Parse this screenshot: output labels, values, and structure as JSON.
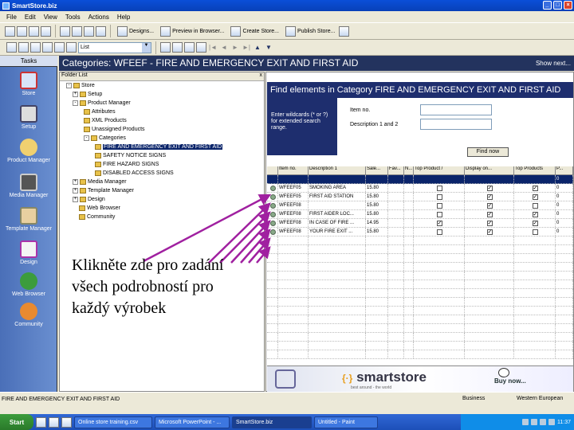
{
  "window": {
    "title": "SmartStore.biz"
  },
  "menu": [
    "File",
    "Edit",
    "View",
    "Tools",
    "Actions",
    "Help"
  ],
  "toolbar1": {
    "buttons": [
      {
        "label": "Designs..."
      },
      {
        "label": "Preview in Browser..."
      },
      {
        "label": "Create Store..."
      },
      {
        "label": "Publish Store..."
      }
    ]
  },
  "toolbar2": {
    "combo_value": "List"
  },
  "tasks": {
    "header": "Tasks",
    "items": [
      {
        "label": "Store",
        "icon": "store-icon"
      },
      {
        "label": "Setup",
        "icon": "setup-icon"
      },
      {
        "label": "Product Manager",
        "icon": "product-manager-icon"
      },
      {
        "label": "Media Manager",
        "icon": "media-manager-icon"
      },
      {
        "label": "Template Manager",
        "icon": "template-manager-icon"
      },
      {
        "label": "Design",
        "icon": "design-icon"
      },
      {
        "label": "Web Browser",
        "icon": "web-browser-icon"
      },
      {
        "label": "Community",
        "icon": "community-icon"
      }
    ]
  },
  "category_header": {
    "title": "Categories: WFEEF - FIRE AND EMERGENCY EXIT AND FIRST AID",
    "show_link": "Show next..."
  },
  "tree": {
    "header": "Folder List",
    "close": "x",
    "nodes": [
      {
        "label": "Store"
      },
      {
        "label": "Setup"
      },
      {
        "label": "Product Manager"
      },
      {
        "label": "Attributes"
      },
      {
        "label": "XML Products"
      },
      {
        "label": "Unassigned Products"
      },
      {
        "label": "Categories"
      },
      {
        "label": "FIRE AND EMERGENCY EXIT AND FIRST AID"
      },
      {
        "label": "SAFETY NOTICE SIGNS"
      },
      {
        "label": "FIRE HAZARD SIGNS"
      },
      {
        "label": "DISABLED ACCESS SIGNS"
      },
      {
        "label": "Media Manager"
      },
      {
        "label": "Template Manager"
      },
      {
        "label": "Design"
      },
      {
        "label": "Web Browser"
      },
      {
        "label": "Community"
      }
    ]
  },
  "find": {
    "title": "Find elements in Category FIRE AND EMERGENCY EXIT AND FIRST AID",
    "hint": "Enter wildcards (* or ?) for extended search range.",
    "label_item": "Item no.",
    "label_desc": "Description 1 and 2",
    "button": "Find now"
  },
  "grid": {
    "columns": [
      "",
      "Item no.",
      "Description 1",
      "Sale...",
      "Fav...",
      "N...",
      "Top Product /",
      "Display on...",
      "Top Products",
      "P..."
    ],
    "rows": [
      {
        "item": "",
        "desc": "",
        "price": "",
        "top": false,
        "display": false,
        "topp": false,
        "last": "0",
        "blue": true
      },
      {
        "item": "WFEEF05",
        "desc": "SMOKING AREA",
        "price": "15.80",
        "top": false,
        "display": true,
        "topp": true,
        "last": "0",
        "blue": false
      },
      {
        "item": "WFEEF05",
        "desc": "FIRST AID STATION",
        "price": "15.80",
        "top": false,
        "display": true,
        "topp": true,
        "last": "0",
        "blue": false
      },
      {
        "item": "WFEEF08",
        "desc": "",
        "price": "15.80",
        "top": false,
        "display": true,
        "topp": false,
        "last": "0",
        "blue": false
      },
      {
        "item": "WFEEF08",
        "desc": "FIRST AIDER LOC...",
        "price": "15.80",
        "top": false,
        "display": true,
        "topp": true,
        "last": "0",
        "blue": false
      },
      {
        "item": "WFEEF08",
        "desc": "IN CASE OF FIRE ...",
        "price": "14.95",
        "top": true,
        "display": true,
        "topp": true,
        "last": "0",
        "blue": false
      },
      {
        "item": "WFEEF08",
        "desc": "YOUR FIRE EXIT ...",
        "price": "15.80",
        "top": false,
        "display": true,
        "topp": false,
        "last": "0",
        "blue": false
      }
    ]
  },
  "banner": {
    "brand": "smartstore",
    "tagline": "best around - the world",
    "buy": "Buy now..."
  },
  "annotation": "Klikněte zde pro zadání všech podrobností pro každý výrobek",
  "statusbar": {
    "path": "FIRE AND EMERGENCY EXIT AND FIRST AID",
    "zone1": "Business",
    "zone2": "Western European"
  },
  "taskbar": {
    "start": "Start",
    "items": [
      {
        "label": "Online store training.csv",
        "active": false
      },
      {
        "label": "Microsoft PowerPoint - ...",
        "active": false
      },
      {
        "label": "SmartStore.biz",
        "active": true
      },
      {
        "label": "Untitled - Paint",
        "active": false
      }
    ],
    "clock": "11:37"
  },
  "colors": {
    "accent": "#1e2e6e",
    "titlebar": "#0a4fd8",
    "tasks_pane": "#4a6fb8",
    "arrows": "#a020a0"
  }
}
